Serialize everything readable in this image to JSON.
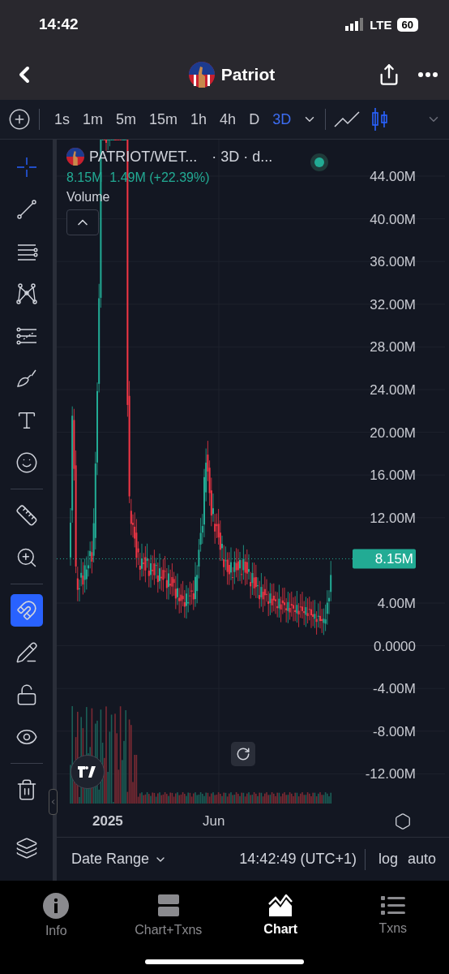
{
  "status_bar": {
    "time": "14:42",
    "network": "LTE",
    "battery": "60"
  },
  "header": {
    "title": "Patriot"
  },
  "intervals": [
    {
      "label": "1s",
      "selected": false
    },
    {
      "label": "1m",
      "selected": false
    },
    {
      "label": "5m",
      "selected": false
    },
    {
      "label": "15m",
      "selected": false
    },
    {
      "label": "1h",
      "selected": false
    },
    {
      "label": "4h",
      "selected": false
    },
    {
      "label": "D",
      "selected": false
    },
    {
      "label": "3D",
      "selected": true
    }
  ],
  "chart_types": [
    {
      "kind": "line",
      "selected": false
    },
    {
      "kind": "candles",
      "selected": true
    }
  ],
  "tool_groups": [
    [
      {
        "kind": "crosshair",
        "selected": true
      },
      {
        "kind": "trend-line",
        "selected": false
      },
      {
        "kind": "fib",
        "selected": false
      },
      {
        "kind": "pattern",
        "selected": false
      },
      {
        "kind": "prediction",
        "selected": false
      },
      {
        "kind": "brush",
        "selected": false
      },
      {
        "kind": "text",
        "selected": false
      },
      {
        "kind": "emoji",
        "selected": false
      }
    ],
    [
      {
        "kind": "ruler",
        "selected": false
      },
      {
        "kind": "zoom",
        "selected": false
      }
    ],
    [
      {
        "kind": "magnet",
        "selected": false,
        "on": true
      },
      {
        "kind": "lock-drawing",
        "selected": false
      },
      {
        "kind": "unlock",
        "selected": false
      },
      {
        "kind": "eye",
        "selected": false
      }
    ],
    [
      {
        "kind": "trash",
        "selected": false
      }
    ]
  ],
  "legend": {
    "symbol": "PATRIOT/WET...",
    "interval": "· 3D · d...",
    "values": "8.15M  1.49M (+22.39%)",
    "indicator": "Volume"
  },
  "y_axis": [
    "44.00M",
    "40.00M",
    "36.00M",
    "32.00M",
    "28.00M",
    "24.00M",
    "20.00M",
    "16.00M",
    "12.00M",
    "4.00M",
    "0.0000",
    "-4.00M",
    "-8.00M",
    "-12.00M"
  ],
  "price_tag": "8.15M",
  "x_axis": [
    {
      "label": "2025",
      "bold": true
    },
    {
      "label": "Jun",
      "bold": false
    }
  ],
  "footer": {
    "date_range": "Date Range",
    "time": "14:42:49 (UTC+1)",
    "scale_buttons": [
      "log",
      "auto"
    ]
  },
  "bottom_nav": [
    {
      "label": "Info",
      "selected": false
    },
    {
      "label": "Chart+Txns",
      "selected": false
    },
    {
      "label": "Chart",
      "selected": true
    },
    {
      "label": "Txns",
      "selected": false
    }
  ]
}
